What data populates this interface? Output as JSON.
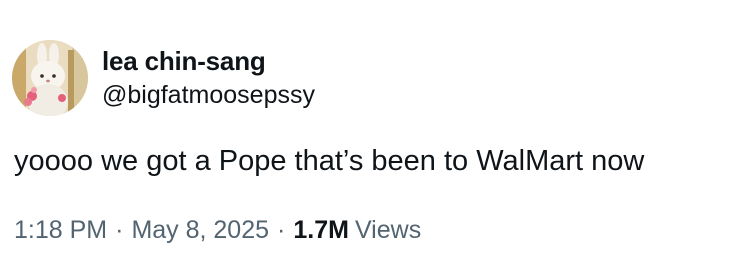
{
  "author": {
    "display_name": "lea chin-sang",
    "handle": "@bigfatmoosepssy",
    "avatar_icon": "plush-bunny-avatar"
  },
  "tweet": {
    "text": "yoooo we got a Pope that’s been to WalMart now"
  },
  "meta": {
    "time": "1:18 PM",
    "separator": "·",
    "date": "May 8, 2025",
    "views_count": "1.7M",
    "views_label": "Views"
  },
  "colors": {
    "text_primary": "#0f1419",
    "text_secondary": "#536471",
    "background": "#ffffff"
  }
}
